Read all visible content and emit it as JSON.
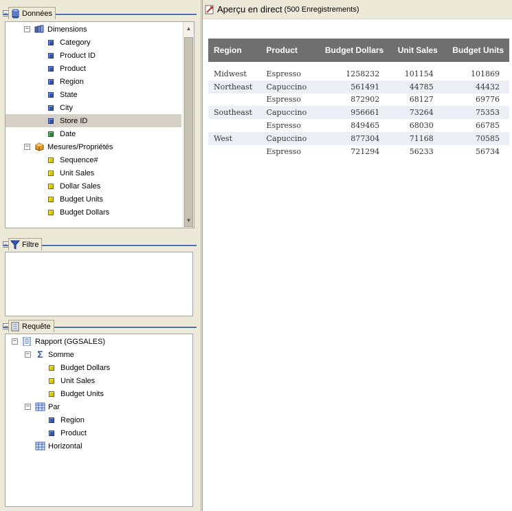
{
  "donnees": {
    "title": "Données",
    "dimensions_label": "Dimensions",
    "dimensions": [
      {
        "label": "Category",
        "type": "dim"
      },
      {
        "label": "Product ID",
        "type": "dim"
      },
      {
        "label": "Product",
        "type": "dim"
      },
      {
        "label": "Region",
        "type": "dim"
      },
      {
        "label": "State",
        "type": "dim"
      },
      {
        "label": "City",
        "type": "dim"
      },
      {
        "label": "Store ID",
        "type": "dim",
        "selected": true
      },
      {
        "label": "Date",
        "type": "date"
      }
    ],
    "measures_label": "Mesures/Propriétés",
    "measures": [
      {
        "label": "Sequence#"
      },
      {
        "label": "Unit Sales"
      },
      {
        "label": "Dollar Sales"
      },
      {
        "label": "Budget Units"
      },
      {
        "label": "Budget Dollars"
      }
    ]
  },
  "filtre": {
    "title": "Filtre"
  },
  "requete": {
    "title": "Requête",
    "report_label": "Rapport (GGSALES)",
    "somme_label": "Somme",
    "somme_items": [
      "Budget Dollars",
      "Unit Sales",
      "Budget Units"
    ],
    "par_label": "Par",
    "par_items": [
      "Region",
      "Product"
    ],
    "horizontal_label": "Horizontal"
  },
  "preview": {
    "title": "Aperçu en direct",
    "count": "(500 Enregistrements)",
    "columns": [
      "Region",
      "Product",
      "Budget Dollars",
      "Unit Sales",
      "Budget Units"
    ],
    "rows": [
      [
        "Midwest",
        "Espresso",
        "1258232",
        "101154",
        "101869"
      ],
      [
        "Northeast",
        "Capuccino",
        "561491",
        "44785",
        "44432"
      ],
      [
        "",
        "Espresso",
        "872902",
        "68127",
        "69776"
      ],
      [
        "Southeast",
        "Capuccino",
        "956661",
        "73264",
        "75353"
      ],
      [
        "",
        "Espresso",
        "849465",
        "68030",
        "66785"
      ],
      [
        "West",
        "Capuccino",
        "877304",
        "71168",
        "70585"
      ],
      [
        "",
        "Espresso",
        "721294",
        "56233",
        "56734"
      ]
    ]
  },
  "colors": {
    "header_bg": "#6f6f6f",
    "shade_row": "#eceff5",
    "accent_line": "#4a6fb0",
    "dimension_leaf": "#3355aa",
    "measure_leaf": "#d8c800",
    "date_leaf": "#2f8a3a"
  }
}
